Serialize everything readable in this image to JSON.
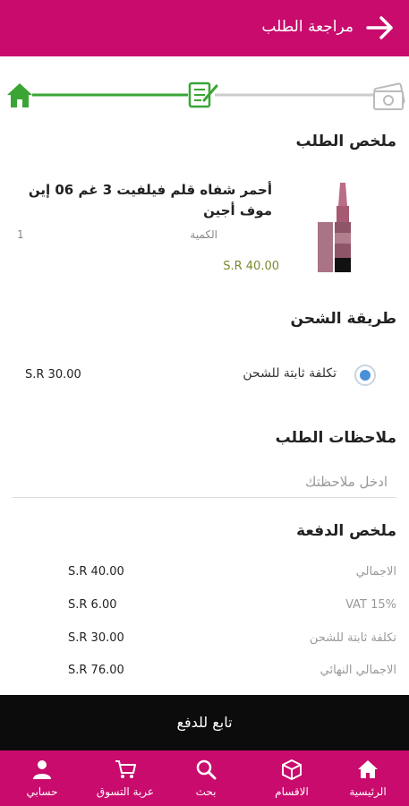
{
  "header": {
    "title": "مراجعة الطلب",
    "back_icon": "arrow-right-icon"
  },
  "progress": {
    "steps": [
      {
        "icon": "home-icon",
        "status": "done"
      },
      {
        "icon": "checklist-icon",
        "status": "current"
      },
      {
        "icon": "payment-icon",
        "status": "pending"
      }
    ],
    "active_color": "#3aa535",
    "inactive_color": "#cccccc"
  },
  "order_summary": {
    "title": "ملخص الطلب",
    "item": {
      "name": "أحمر شفاه قلم فيلفيت 3 غم 06 إين موف أجين",
      "quantity_label": "الكمية",
      "quantity": "1",
      "price": "S.R 40.00",
      "image_icon": "lipstick-pencil-image"
    }
  },
  "shipping": {
    "title": "طريقة الشحن",
    "option_label": "تكلفة ثابتة للشحن",
    "option_price": "S.R 30.00",
    "selected": true
  },
  "notes": {
    "title": "ملاحظات الطلب",
    "placeholder": "ادخل ملاحظتك",
    "value": ""
  },
  "payment_summary": {
    "title": "ملخص الدفعة",
    "rows": [
      {
        "label": "الاجمالي",
        "value": "S.R 40.00"
      },
      {
        "label": "VAT 15%",
        "value": "S.R 6.00"
      },
      {
        "label": "تكلفة ثابتة للشحن",
        "value": "S.R 30.00"
      },
      {
        "label": "الاجمالي النهائي",
        "value": "S.R 76.00"
      }
    ]
  },
  "continue_button": "تابع للدفع",
  "bottom_nav": {
    "items": [
      {
        "label": "الرئيسية",
        "icon": "home-icon"
      },
      {
        "label": "الاقسام",
        "icon": "categories-cube-icon"
      },
      {
        "label": "بحث",
        "icon": "search-icon"
      },
      {
        "label": "عربة التسوق",
        "icon": "shopping-cart-icon"
      },
      {
        "label": "حسابي",
        "icon": "user-icon"
      }
    ]
  },
  "colors": {
    "brand": "#c80b6d",
    "button": "#0c0c0c",
    "price": "#7a8a2f",
    "radio": "#4a90d9"
  }
}
